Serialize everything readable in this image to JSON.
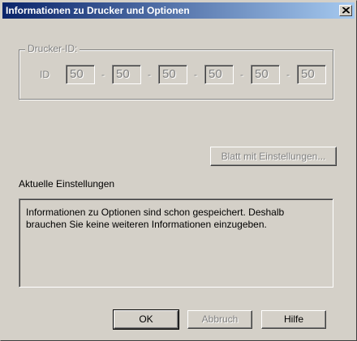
{
  "window": {
    "title": "Informationen zu Drucker und Optionen",
    "close_icon": "close-icon"
  },
  "printer_id_group": {
    "label": "Drucker-ID:",
    "id_label": "ID",
    "fields": [
      "50",
      "50",
      "50",
      "50",
      "50",
      "50"
    ],
    "separator": "-"
  },
  "settings_sheet_button": {
    "label": "Blatt mit Einstellungen...",
    "enabled": false
  },
  "current_settings": {
    "label": "Aktuelle Einstellungen",
    "text": "Informationen zu Optionen sind schon gespeichert. Deshalb brauchen Sie keine weiteren Informationen einzugeben."
  },
  "buttons": {
    "ok": "OK",
    "cancel": "Abbruch",
    "help": "Hilfe"
  },
  "colors": {
    "title_start": "#0a246a",
    "title_end": "#a6caf0",
    "face": "#d4d0c8",
    "disabled_text": "#808080"
  }
}
